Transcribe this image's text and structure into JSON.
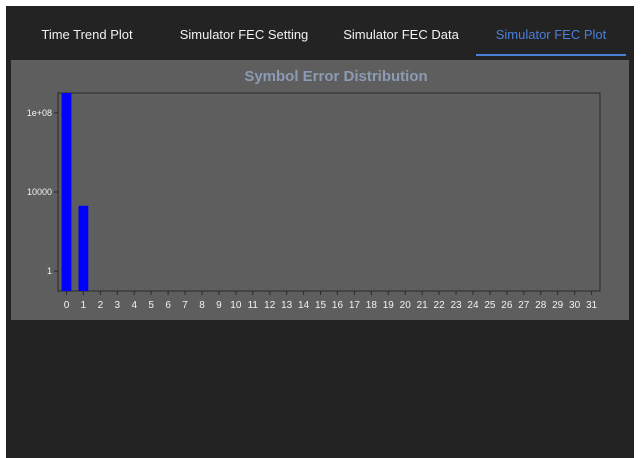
{
  "tabs": [
    {
      "label": "Time Trend Plot",
      "active": false
    },
    {
      "label": "Simulator FEC Setting",
      "active": false
    },
    {
      "label": "Simulator FEC Data",
      "active": false
    },
    {
      "label": "Simulator FEC Plot",
      "active": true
    }
  ],
  "colors": {
    "accent": "#4c7fd8",
    "bar": "#0000ff",
    "panel_bg": "#5e5e5e",
    "window_bg": "#232323",
    "title": "#8b9bb3"
  },
  "chart_data": {
    "type": "bar",
    "title": "Symbol Error Distribution",
    "xlabel": "",
    "ylabel": "",
    "y_scale": "log",
    "ylim": [
      0.1,
      1000000000
    ],
    "yticks": [
      {
        "value": 1,
        "label": "1"
      },
      {
        "value": 10000,
        "label": "10000"
      },
      {
        "value": 100000000,
        "label": "1e+08"
      }
    ],
    "categories": [
      "0",
      "1",
      "2",
      "3",
      "4",
      "5",
      "6",
      "7",
      "8",
      "9",
      "10",
      "11",
      "12",
      "13",
      "14",
      "15",
      "16",
      "17",
      "18",
      "19",
      "20",
      "21",
      "22",
      "23",
      "24",
      "25",
      "26",
      "27",
      "28",
      "29",
      "30",
      "31"
    ],
    "values": [
      1000000000,
      2000,
      0,
      0,
      0,
      0,
      0,
      0,
      0,
      0,
      0,
      0,
      0,
      0,
      0,
      0,
      0,
      0,
      0,
      0,
      0,
      0,
      0,
      0,
      0,
      0,
      0,
      0,
      0,
      0,
      0,
      0
    ],
    "grid": false,
    "legend": "none"
  }
}
